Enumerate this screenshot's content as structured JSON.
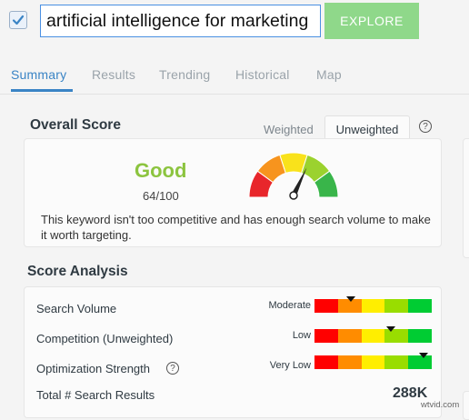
{
  "search": {
    "value": "artificial intelligence for marketing",
    "checked": true
  },
  "toolbar": {
    "explore_label": "EXPLORE"
  },
  "tabs": [
    {
      "label": "Summary",
      "active": true
    },
    {
      "label": "Results"
    },
    {
      "label": "Trending"
    },
    {
      "label": "Historical"
    },
    {
      "label": "Map"
    }
  ],
  "overall": {
    "title": "Overall Score",
    "weighted_label": "Weighted",
    "unweighted_label": "Unweighted",
    "help_glyph": "?",
    "score_word": "Good",
    "score_text": "64/100",
    "score_value": 64,
    "score_max": 100,
    "description": "This keyword isn't too competitive and has enough search volume to make it worth targeting.",
    "gauge_colors": [
      "#e8262b",
      "#f7941e",
      "#f9e21b",
      "#9bd22e",
      "#39b54a"
    ]
  },
  "analysis": {
    "title": "Score Analysis",
    "bar_colors": [
      "#ff0000",
      "#ff8c00",
      "#ffee00",
      "#99dd00",
      "#00cc33"
    ],
    "metrics": [
      {
        "label": "Search Volume",
        "level": "Moderate",
        "marker_fraction": 0.31
      },
      {
        "label": "Competition (Unweighted)",
        "level": "Low",
        "marker_fraction": 0.65
      },
      {
        "label": "Optimization Strength",
        "level": "Very Low",
        "marker_fraction": 0.93,
        "has_help": true
      }
    ],
    "total_label": "Total # Search Results",
    "total_value": "288K"
  },
  "watermark": "wtvid.com",
  "colors": {
    "accent": "#3a84c5",
    "good": "#8cc43f",
    "explore": "#8fd88a"
  }
}
